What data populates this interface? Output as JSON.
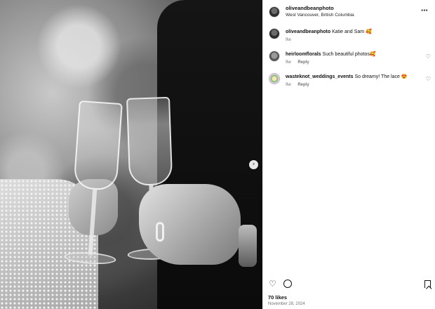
{
  "post": {
    "username": "oliveandbeanphoto",
    "location": "West Vancouver, British Columbia",
    "more_icon": "more-horizontal-icon"
  },
  "comments": [
    {
      "username": "oliveandbeanphoto",
      "text": "Katie and Sam 🥰",
      "time": "9w",
      "reply": ""
    },
    {
      "username": "heirloomflorals",
      "text": "Such beautiful photos🥰",
      "time": "9w",
      "reply": "Reply"
    },
    {
      "username": "wasteknot_weddings_events",
      "text": "So dreamy! The lace 😍",
      "time": "9w",
      "reply": "Reply"
    }
  ],
  "actions": {
    "like_icon": "heart-icon",
    "comment_icon": "comment-icon",
    "save_icon": "bookmark-icon"
  },
  "likes": "70 likes",
  "date": "November 28, 2024",
  "carousel": {
    "next_icon": "chevron-right-icon"
  }
}
